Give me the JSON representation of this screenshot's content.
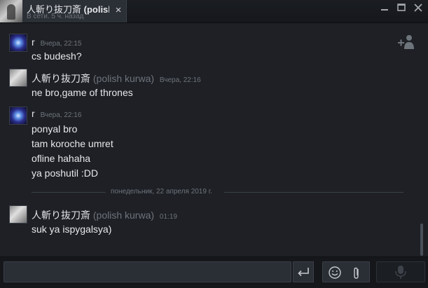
{
  "window": {
    "tab": {
      "name_part1": "人斬り抜刀斎 ",
      "name_part2": "(polish",
      "status": "В сети. 5 ч. назад",
      "close_glyph": "×"
    },
    "controls": [
      "minimize-icon",
      "maximize-icon",
      "close-icon"
    ]
  },
  "chat": {
    "messages": [
      {
        "sender": "r",
        "nickname": "",
        "time": "Вчера, 22:15",
        "avatar": "galaxy",
        "lines": [
          "cs budesh?"
        ]
      },
      {
        "sender": "人斬り抜刀斎",
        "nickname": "(polish kurwa)",
        "time": "Вчера, 22:16",
        "avatar": "samurai",
        "lines": [
          "ne bro,game of thrones"
        ]
      },
      {
        "sender": "r",
        "nickname": "",
        "time": "Вчера, 22:16",
        "avatar": "galaxy",
        "lines": [
          "ponyal bro",
          "tam koroche umret",
          "ofline hahaha",
          "ya poshutil :DD"
        ]
      },
      {
        "sender": "人斬り抜刀斎",
        "nickname": "(polish kurwa)",
        "time": "01:19",
        "avatar": "samurai",
        "lines": [
          "suk ya ispygalsya)"
        ]
      }
    ],
    "date_divider": "понедельник, 22 апреля 2019 г."
  },
  "composer": {
    "input_value": "",
    "send_icon": "enter-arrow-icon",
    "emoticon_icon": "smiley-icon",
    "attach_icon": "paperclip-icon",
    "voice_icon": "microphone-icon"
  },
  "colors": {
    "background": "#1e2025",
    "title_bar": "#15171b",
    "text": "#e6e8ea",
    "muted": "#6e747c"
  }
}
